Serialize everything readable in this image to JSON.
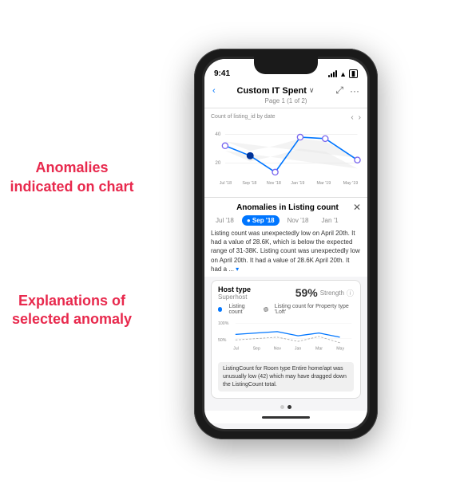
{
  "left_labels": {
    "label1": "Anomalies indicated on chart",
    "label2": "Explanations of selected anomaly"
  },
  "status_bar": {
    "time": "9:41",
    "battery": "●●●",
    "wifi": "WiFi",
    "signal": "Signal"
  },
  "header": {
    "back_icon": "‹",
    "title": "Custom IT Spent",
    "chevron": "∨",
    "expand_icon": "⤢",
    "more_icon": "···",
    "subtitle": "Page 1 (1 of 2)"
  },
  "chart": {
    "label": "Count of listing_id by date",
    "y_labels": [
      "40",
      "20"
    ],
    "x_labels": [
      "Jul '18",
      "Sep '18",
      "Nov '18",
      "Jan '19",
      "Mar '19",
      "May '19"
    ],
    "nav_left": "‹",
    "nav_right": "›"
  },
  "anomaly_panel": {
    "title": "Anomalies in Listing count",
    "close": "✕",
    "tabs": [
      {
        "label": "Jul '18",
        "active": false
      },
      {
        "label": "Sep '18",
        "active": true
      },
      {
        "label": "Nov '18",
        "active": false
      },
      {
        "label": "Jan '1",
        "active": false
      }
    ],
    "description": "Listing count was unexpectedly low on April 20th. It had a value of 28.6K, which is below the expected range of 31-38K. Listing count was unexpectedly low on April 20th. It had a value of 28.6K April 20th. It had a ...",
    "expand_label": "▾"
  },
  "host_card": {
    "type_label": "Host type",
    "type_value": "Superhost",
    "strength_pct": "59%",
    "strength_label": "Strength",
    "info_icon": "ⓘ",
    "mini_chart_labels": [
      "100%",
      "50%"
    ],
    "x_labels": [
      "Jul",
      "Sep",
      "Nov",
      "Jan",
      "Mar",
      "May"
    ],
    "legend": [
      {
        "label": "Listing count",
        "type": "solid",
        "color": "#0076ff"
      },
      {
        "label": "Listing count for Property type 'Loft'",
        "type": "dashed",
        "color": "#888"
      }
    ],
    "footnote": "ListingCount for Room type Entire home/apt was unusually low (42) which may have dragged down the ListingCount total."
  },
  "pagination": {
    "dots": [
      {
        "active": false
      },
      {
        "active": true
      }
    ]
  }
}
